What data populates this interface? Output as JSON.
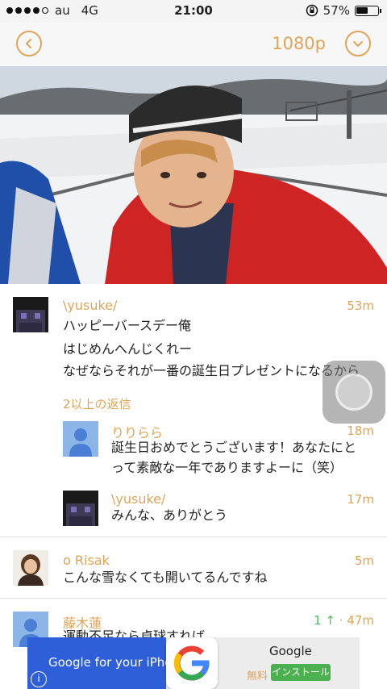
{
  "status_bar": {
    "carrier": "au",
    "network": "4G",
    "time": "21:00",
    "battery_text": "57%",
    "battery_level": 0.57,
    "signal_bars": 4
  },
  "player": {
    "quality": "1080p",
    "back_icon": "chevron-left-icon",
    "menu_icon": "chevron-down-icon"
  },
  "comments": [
    {
      "user": "\\yusuke/",
      "time": "53m",
      "lines": [
        "ハッピーバースデー俺",
        "はじめんへんじくれー",
        "なぜならそれが一番の誕生日プレゼントになるから"
      ],
      "more_replies": "2以上の返信",
      "replies": [
        {
          "user": "りりらら",
          "time": "18m",
          "lines": [
            "誕生日おめでとうございます！あなたにと",
            "って素敵な一年でありますよーに（笑）"
          ]
        },
        {
          "user": "\\yusuke/",
          "time": "17m",
          "lines": [
            "みんな、ありがとう"
          ]
        }
      ]
    },
    {
      "user": "o Risak",
      "time": "5m",
      "lines": [
        "こんな雪なくても開いてるんですね"
      ]
    },
    {
      "user": "藤木蓮",
      "votes": "1",
      "time": "47m",
      "lines": [
        "運動不足なら卓球すれば"
      ]
    }
  ],
  "ad": {
    "text": "Google for your iPhone",
    "brand": "Google",
    "price": "無料",
    "install_label": "インストール",
    "info_label": "i"
  },
  "colors": {
    "accent": "#e0a458",
    "upvote": "#4cc25d",
    "ad_blue": "#2f5fd8",
    "install_green": "#4caf50"
  }
}
